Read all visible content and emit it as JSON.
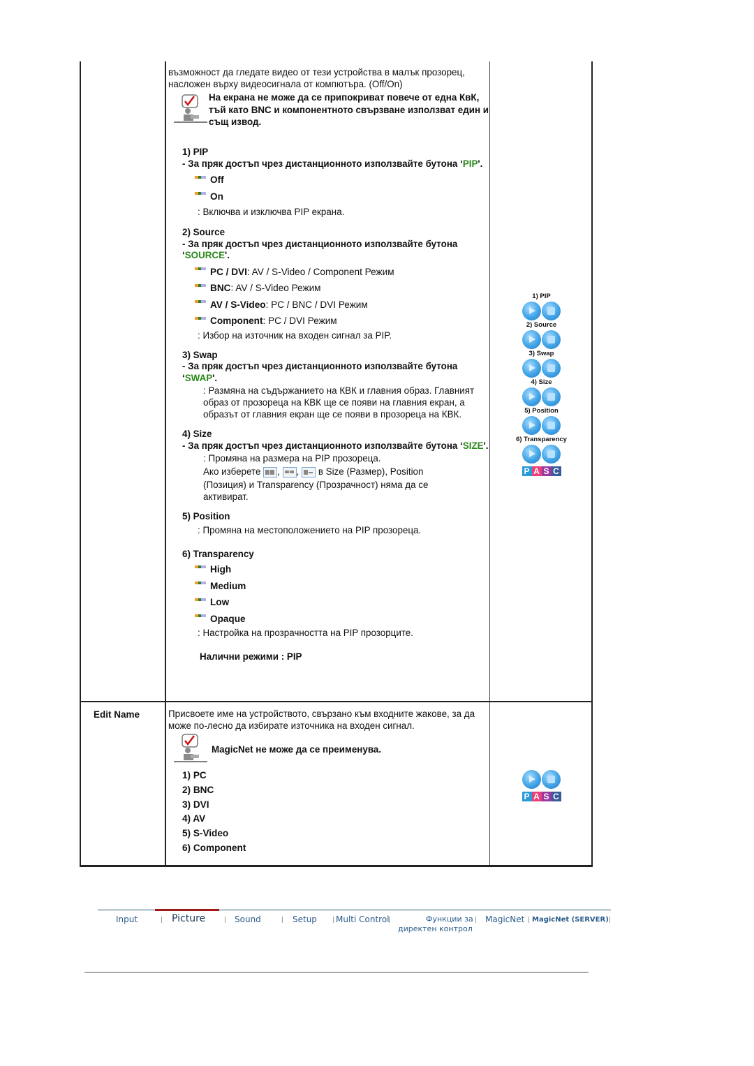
{
  "intro_text": "възможност да гледате видео от тези устройства в малък прозорец, насложен върху видеосигнала от компютъра. (Off/On)",
  "note1": "На екрана не може да се припокриват повече от една КвК, тъй като BNC и компонентното свързване използват един и същ извод.",
  "direct_prefix": "- За пряк достъп чрез дистанционното използвайте бутона ‘",
  "direct_suffix": "'.",
  "sections": {
    "pip": {
      "title": "1) PIP",
      "button": "PIP",
      "options": [
        "Off",
        "On"
      ],
      "desc": ": Включва и изключва PIP екрана."
    },
    "source": {
      "title": "2) Source",
      "button": "SOURCE",
      "options": [
        {
          "bold": "PC / DVI",
          "rest": " : AV / S-Video / Component Режим"
        },
        {
          "bold": "BNC",
          "rest": " : AV / S-Video Режим"
        },
        {
          "bold": "AV / S-Video",
          "rest": " : PC / BNC / DVI Режим"
        },
        {
          "bold": "Component",
          "rest": ": PC / DVI Режим"
        }
      ],
      "desc": ": Избор на източник на входен сигнал за PIP."
    },
    "swap": {
      "title": "3) Swap",
      "button": "SWAP",
      "desc": ": Размяна на съдържанието на КВК и главния образ. Главният образ от прозореца на КВК ще се появи на главния екран, а образът от главния екран ще се появи в прозореца на КВК."
    },
    "size": {
      "title": "4) Size",
      "button": "SIZE",
      "desc": ": Промяна на размера на PIP прозореца.",
      "desc2_a": "Ако изберете",
      "desc2_b": "в Size (Размер), Position",
      "desc3": "(Позиция) и Transparency (Прозрачност) няма да се активират."
    },
    "position": {
      "title": "5) Position",
      "desc": ": Промяна на местоположението на PIP прозореца."
    },
    "transparency": {
      "title": "6) Transparency",
      "options": [
        "High",
        "Medium",
        "Low",
        "Opaque"
      ],
      "desc": ": Настройка на прозрачността на PIP прозорците."
    },
    "modes": "Налични режими : PIP"
  },
  "remote_labels": [
    "1) PIP",
    "2) Source",
    "3) Swap",
    "4) Size",
    "5) Position",
    "6) Transparency"
  ],
  "pasc": [
    "P",
    "A",
    "S",
    "C"
  ],
  "pasc_colors": [
    "#2a9ad8",
    "#e8407a",
    "#9a3aa0",
    "#3a5a9a"
  ],
  "edit_name": {
    "label": "Edit Name",
    "desc": "Присвоете име на устройството, свързано към входните жакове, за да може по-лесно да избирате източника на входен сигнал.",
    "note": "MagicNet не може да се преименува.",
    "items": [
      "1) PC",
      "2) BNC",
      "3) DVI",
      "4) AV",
      "5) S-Video",
      "6) Component"
    ]
  },
  "nav": {
    "items": [
      "Input",
      "Picture",
      "Sound",
      "Setup",
      "Multi Control",
      "Функции за",
      "директен контрол",
      "MagicNet",
      "MagicNet (SERVER)"
    ],
    "active": "Picture",
    "active_color": "#a01818"
  }
}
